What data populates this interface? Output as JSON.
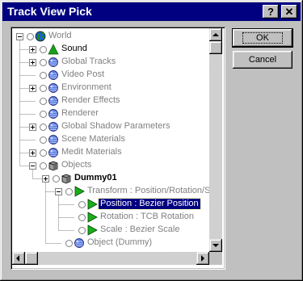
{
  "window": {
    "title": "Track View Pick"
  },
  "titlebar_buttons": {
    "help": "?",
    "close": "✕"
  },
  "buttons": {
    "ok": "OK",
    "cancel": "Cancel"
  },
  "tree": {
    "items": [
      {
        "label": "World",
        "icon": "globe-icon",
        "expander": "minus",
        "level": 0,
        "enabled": false
      },
      {
        "label": "Sound",
        "icon": "cone-icon",
        "expander": "plus",
        "level": 1,
        "enabled": true
      },
      {
        "label": "Global Tracks",
        "icon": "sphere-icon",
        "expander": "plus",
        "level": 1,
        "enabled": false
      },
      {
        "label": "Video Post",
        "icon": "sphere-icon",
        "expander": "none",
        "level": 1,
        "enabled": false
      },
      {
        "label": "Environment",
        "icon": "sphere-icon",
        "expander": "plus",
        "level": 1,
        "enabled": false
      },
      {
        "label": "Render Effects",
        "icon": "sphere-icon",
        "expander": "none",
        "level": 1,
        "enabled": false
      },
      {
        "label": "Renderer",
        "icon": "sphere-icon",
        "expander": "none",
        "level": 1,
        "enabled": false
      },
      {
        "label": "Global Shadow Parameters",
        "icon": "sphere-icon",
        "expander": "plus",
        "level": 1,
        "enabled": false
      },
      {
        "label": "Scene Materials",
        "icon": "sphere-icon",
        "expander": "none",
        "level": 1,
        "enabled": false
      },
      {
        "label": "Medit Materials",
        "icon": "sphere-icon",
        "expander": "plus",
        "level": 1,
        "enabled": false
      },
      {
        "label": "Objects",
        "icon": "box-icon",
        "expander": "minus",
        "level": 1,
        "enabled": false
      },
      {
        "label": "Dummy01",
        "icon": "box-icon",
        "expander": "plus",
        "level": 2,
        "enabled": true
      },
      {
        "label": "Transform : Position/Rotation/Scale",
        "icon": "triangle-icon",
        "expander": "minus",
        "level": 3,
        "enabled": false
      },
      {
        "label": "Position : Bezier Position",
        "icon": "triangle-icon",
        "expander": "none",
        "level": 4,
        "enabled": true,
        "selected": true
      },
      {
        "label": "Rotation : TCB Rotation",
        "icon": "triangle-icon",
        "expander": "none",
        "level": 4,
        "enabled": false
      },
      {
        "label": "Scale : Bezier Scale",
        "icon": "triangle-icon",
        "expander": "none",
        "level": 4,
        "enabled": false
      },
      {
        "label": "Object (Dummy)",
        "icon": "sphere-icon",
        "expander": "none",
        "level": 3,
        "enabled": false
      }
    ]
  },
  "colors": {
    "titlebar": "#000080",
    "selection": "#000080",
    "disabled_text": "#808080",
    "face": "#c0c0c0"
  }
}
